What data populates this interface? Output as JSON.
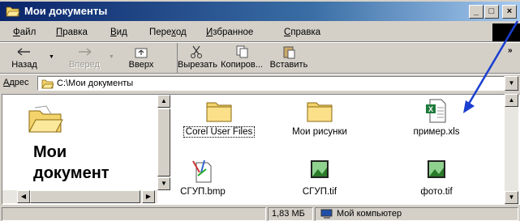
{
  "window": {
    "title": "Мои документы",
    "icons": {
      "title": "folder-open-icon"
    },
    "caption_buttons": [
      "_",
      "□",
      "×"
    ]
  },
  "menu": [
    {
      "label": "Файл",
      "hotkey": "Ф",
      "rest": "айл"
    },
    {
      "label": "Правка",
      "hotkey": "П",
      "rest": "равка"
    },
    {
      "label": "Вид",
      "hotkey": "В",
      "rest": "ид"
    },
    {
      "label": "Переход",
      "pre": "Пере",
      "hotkey": "х",
      "rest": "од"
    },
    {
      "label": "Избранное",
      "hotkey": "И",
      "rest": "збранное"
    },
    {
      "label": "Справка",
      "hotkey": "С",
      "rest": "правка"
    }
  ],
  "toolbar": {
    "back": "Назад",
    "forward": "Вперед",
    "up": "Вверх",
    "cut": "Вырезать",
    "copy": "Копиров...",
    "paste": "Вставить"
  },
  "address": {
    "label": "Адрес",
    "label_hotkey": "А",
    "label_rest": "дрес",
    "path": "C:\\Мои документы"
  },
  "left_pane": {
    "heading_line1": "Мои",
    "heading_line2": "документ"
  },
  "files": [
    {
      "name": "Corel User Files",
      "icon": "folder-icon",
      "focused": true
    },
    {
      "name": "Мои рисунки",
      "icon": "folder-icon",
      "focused": false
    },
    {
      "name": "пример.xls",
      "icon": "excel-file-icon",
      "focused": false
    },
    {
      "name": "СГУП.bmp",
      "icon": "bmp-file-icon",
      "focused": false
    },
    {
      "name": "СГУП.tif",
      "icon": "image-file-icon",
      "focused": false
    },
    {
      "name": "фото.tif",
      "icon": "image-file-icon",
      "focused": false
    }
  ],
  "status": {
    "size": "1,83 МБ",
    "location": "Мой компьютер"
  },
  "colors": {
    "titlebar_start": "#0a246a",
    "titlebar_end": "#a6caf0",
    "face": "#d4d0c8",
    "annotation_arrow": "#1a3fd0"
  }
}
